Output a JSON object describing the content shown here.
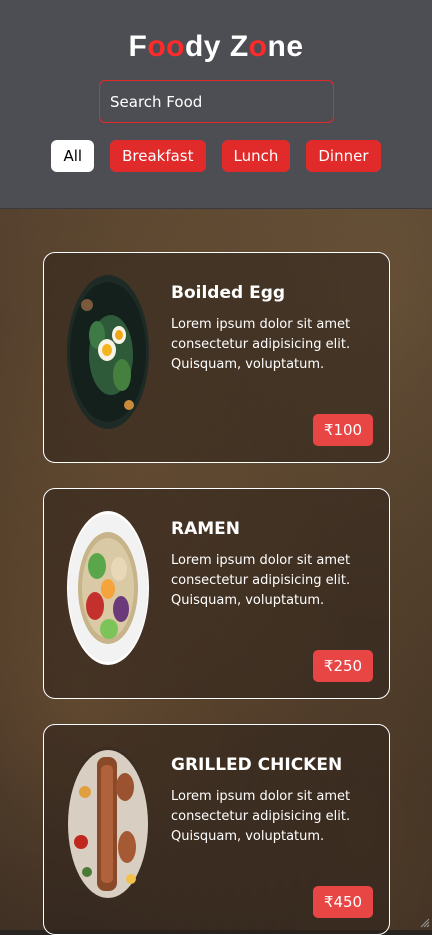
{
  "app": {
    "logo": {
      "letters": [
        {
          "ch": "F",
          "red": false
        },
        {
          "ch": "o",
          "red": true
        },
        {
          "ch": "o",
          "red": true
        },
        {
          "ch": "d",
          "red": false
        },
        {
          "ch": "y",
          "red": false
        },
        {
          "ch": " ",
          "red": false
        },
        {
          "ch": "Z",
          "red": false
        },
        {
          "ch": "o",
          "red": true
        },
        {
          "ch": "n",
          "red": false
        },
        {
          "ch": "e",
          "red": false
        }
      ]
    },
    "search": {
      "placeholder": "Search Food",
      "value": ""
    },
    "filters": [
      {
        "label": "All",
        "active": true
      },
      {
        "label": "Breakfast",
        "active": false
      },
      {
        "label": "Lunch",
        "active": false
      },
      {
        "label": "Dinner",
        "active": false
      }
    ]
  },
  "foods": [
    {
      "name": "Boilded Egg",
      "description": "Lorem ipsum dolor sit amet consectetur adipisicing elit. Quisquam, voluptatum.",
      "price": "₹100",
      "image_icon": "egg-salad-plate-icon"
    },
    {
      "name": "RAMEN",
      "description": "Lorem ipsum dolor sit amet consectetur adipisicing elit. Quisquam, voluptatum.",
      "price": "₹250",
      "image_icon": "ramen-bowl-icon"
    },
    {
      "name": "GRILLED CHICKEN",
      "description": "Lorem ipsum dolor sit amet consectetur adipisicing elit. Quisquam, voluptatum.",
      "price": "₹450",
      "image_icon": "grilled-chicken-platter-icon"
    }
  ],
  "colors": {
    "accent": "#e12a2a",
    "header_bg": "#4d4e54",
    "price_bg": "#e84545"
  }
}
